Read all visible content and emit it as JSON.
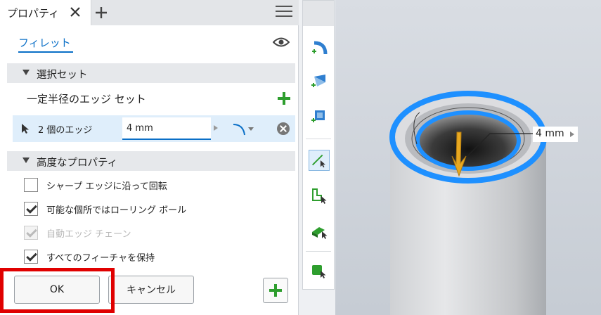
{
  "tab": {
    "title": "プロパティ"
  },
  "feature": {
    "name": "フィレット"
  },
  "sections": {
    "selection": "選択セット",
    "advanced": "高度なプロパティ"
  },
  "edge_set": {
    "label": "一定半径のエッジ セット",
    "row_label": "2 個のエッジ",
    "radius": "4 mm"
  },
  "options": [
    {
      "label": "シャープ エッジに沿って回転",
      "checked": false,
      "enabled": true
    },
    {
      "label": "可能な個所ではローリング ボール",
      "checked": true,
      "enabled": true
    },
    {
      "label": "自動エッジ チェーン",
      "checked": true,
      "enabled": false
    },
    {
      "label": "すべてのフィーチャを保持",
      "checked": true,
      "enabled": true
    }
  ],
  "buttons": {
    "ok": "OK",
    "cancel": "キャンセル"
  },
  "viewport": {
    "dimension": "4 mm"
  },
  "colors": {
    "accent": "#0a6fc7",
    "add": "#2e9e2e",
    "highlight": "#e00000",
    "selected_edge": "#1e90ff"
  }
}
